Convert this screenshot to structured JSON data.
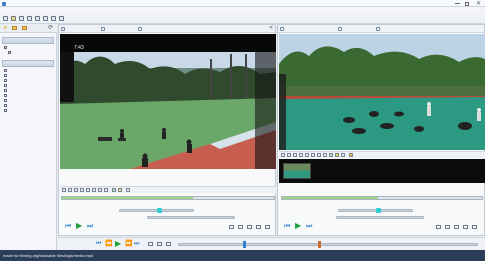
{
  "window": {
    "title": "",
    "menu": [
      "",
      "",
      "",
      "",
      "",
      "",
      "",
      "",
      ""
    ]
  },
  "left_panel": {
    "section1_title": "",
    "section1_items": [
      "",
      ""
    ],
    "section2_title": "",
    "section2_items": [
      "",
      "",
      "",
      "",
      "",
      "",
      "",
      "",
      ""
    ]
  },
  "left_video": {
    "header_items": [
      "",
      "",
      ""
    ],
    "overlay_time": "7:43",
    "time_row": {
      "a": "",
      "b": "",
      "c": ""
    },
    "range_row": {
      "a": "",
      "b": ""
    },
    "progress_fraction": 0.62,
    "progress_color": "#2ecfd1"
  },
  "right_video": {
    "header_items": [
      "",
      "",
      ""
    ],
    "time_row": {
      "a": "",
      "b": "",
      "c": ""
    },
    "range_row": {
      "a": "",
      "b": ""
    },
    "progress_fraction": 0.48,
    "progress_color": "#2ecfd1"
  },
  "bottom": {
    "label": ""
  },
  "statusbar": {
    "text": "made for filming.org/trackable files/logs/media.mp4"
  },
  "colors": {
    "accent_green": "#21a33a",
    "accent_blue": "#2f7fd0",
    "statusbar_bg": "#2c3e57"
  }
}
